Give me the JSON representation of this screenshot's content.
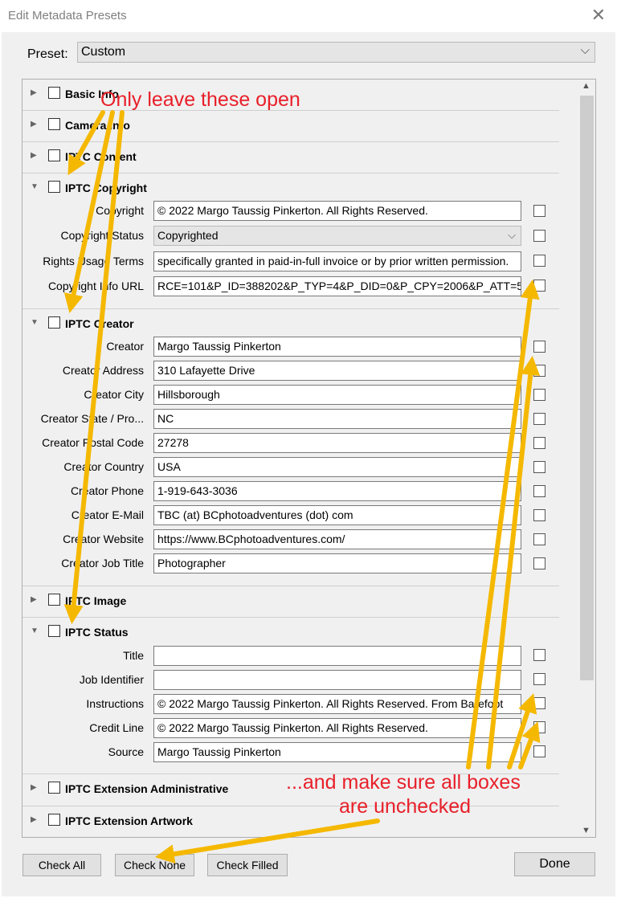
{
  "window": {
    "title": "Edit Metadata Presets"
  },
  "preset": {
    "label": "Preset:",
    "value": "Custom"
  },
  "sections": {
    "basic_info": {
      "title": "Basic Info"
    },
    "camera_info": {
      "title": "Camera Info"
    },
    "iptc_content": {
      "title": "IPTC Content"
    },
    "iptc_copyright": {
      "title": "IPTC Copyright",
      "fields": [
        {
          "label": "Copyright",
          "value": "© 2022 Margo Taussig Pinkerton.  All Rights Reserved."
        },
        {
          "label": "Copyright Status",
          "value": "Copyrighted"
        },
        {
          "label": "Rights Usage Terms",
          "value": "specifically granted in paid-in-full invoice or by prior written permission."
        },
        {
          "label": "Copyright Info URL",
          "value": "RCE=101&P_ID=388202&P_TYP=4&P_DID=0&P_CPY=2006&P_ATT=5"
        }
      ]
    },
    "iptc_creator": {
      "title": "IPTC Creator",
      "fields": [
        {
          "label": "Creator",
          "value": "Margo Taussig Pinkerton"
        },
        {
          "label": "Creator Address",
          "value": "310 Lafayette Drive"
        },
        {
          "label": "Creator City",
          "value": "Hillsborough"
        },
        {
          "label": "Creator State / Pro...",
          "value": "NC"
        },
        {
          "label": "Creator Postal Code",
          "value": "27278"
        },
        {
          "label": "Creator Country",
          "value": "USA"
        },
        {
          "label": "Creator Phone",
          "value": "1-919-643-3036"
        },
        {
          "label": "Creator E-Mail",
          "value": "TBC (at) BCphotoadventures (dot) com"
        },
        {
          "label": "Creator Website",
          "value": "https://www.BCphotoadventures.com/"
        },
        {
          "label": "Creator Job Title",
          "value": "Photographer"
        }
      ]
    },
    "iptc_image": {
      "title": "IPTC Image"
    },
    "iptc_status": {
      "title": "IPTC Status",
      "fields": [
        {
          "label": "Title",
          "value": ""
        },
        {
          "label": "Job Identifier",
          "value": ""
        },
        {
          "label": "Instructions",
          "value": "© 2022 Margo Taussig Pinkerton.  All Rights Reserved.  From Barefoot"
        },
        {
          "label": "Credit Line",
          "value": "© 2022 Margo Taussig Pinkerton.  All Rights Reserved."
        },
        {
          "label": "Source",
          "value": "Margo Taussig Pinkerton"
        }
      ]
    },
    "iptc_ext_admin": {
      "title": "IPTC Extension Administrative"
    },
    "iptc_ext_artwork": {
      "title": "IPTC Extension Artwork"
    }
  },
  "buttons": {
    "check_all": "Check All",
    "check_none": "Check None",
    "check_filled": "Check Filled",
    "done": "Done"
  },
  "annotations": {
    "top_note": "Only leave these open",
    "bottom_note_line1": "...and make sure all boxes",
    "bottom_note_line2": "are unchecked",
    "text_color": "#e8202a",
    "arrow_color": "#f5b800"
  },
  "icons": {
    "collapsed": "triangle-right-icon",
    "expanded": "triangle-down-icon",
    "dropdown": "chevron-down-icon",
    "close": "close-icon"
  }
}
